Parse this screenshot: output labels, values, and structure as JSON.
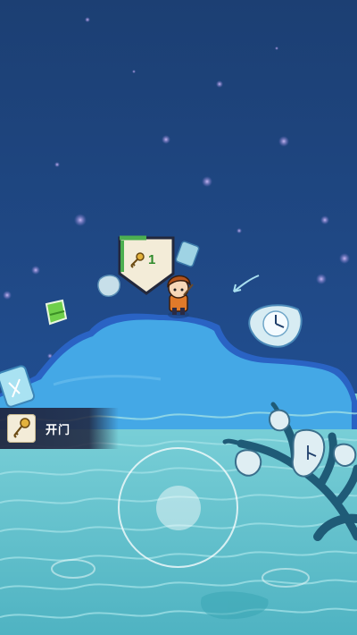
{
  "action": {
    "icon": "key-icon",
    "label": "开门"
  },
  "key_badge": {
    "icon": "key-icon",
    "count": "1"
  },
  "joystick": {
    "icon": "virtual-joystick"
  },
  "colors": {
    "sky": "#1f4c86",
    "island": "#3f9fe0",
    "island_edge": "#2b66c8",
    "sea": "#63c5cf",
    "ui_panel": "#1e223c",
    "badge_green": "#4caf50",
    "badge_paper": "#f3ecd8"
  }
}
